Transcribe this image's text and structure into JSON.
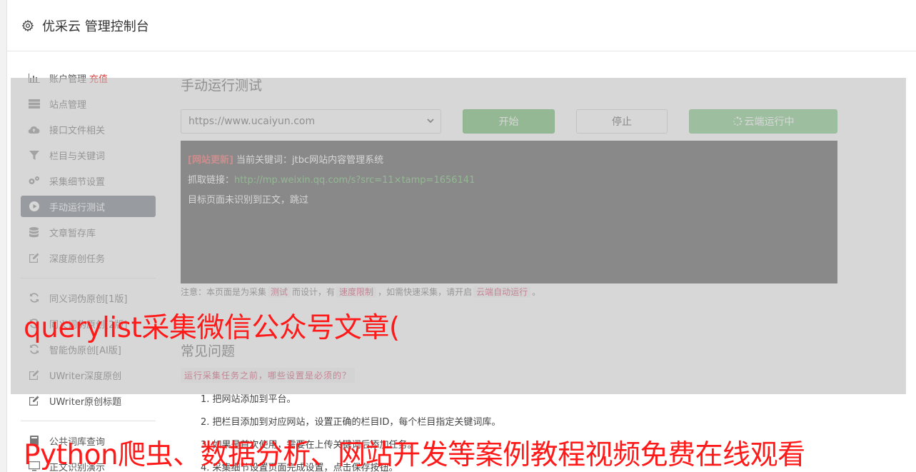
{
  "header": {
    "title": "优采云 管理控制台",
    "icon": "gear-icon"
  },
  "sidebar": {
    "items": [
      {
        "label": "账户管理",
        "extra": "充值",
        "icon": "bar-chart-icon"
      },
      {
        "label": "站点管理",
        "icon": "server-icon"
      },
      {
        "label": "接口文件相关",
        "icon": "cloud-upload-icon"
      },
      {
        "label": "栏目与关键词",
        "icon": "filter-icon"
      },
      {
        "label": "采集细节设置",
        "icon": "gears-icon"
      },
      {
        "label": "手动运行测试",
        "icon": "play-circle-icon",
        "active": true
      },
      {
        "label": "文章暂存库",
        "icon": "database-icon"
      },
      {
        "label": "深度原创任务",
        "icon": "edit-icon"
      },
      {
        "label": "同义词伪原创[1版]",
        "icon": "refresh-icon"
      },
      {
        "label": "同义词伪原创[2版]",
        "icon": "refresh-icon"
      },
      {
        "label": "智能伪原创[AI版]",
        "icon": "refresh-icon"
      },
      {
        "label": "UWriter深度原创",
        "icon": "edit-icon"
      },
      {
        "label": "UWriter原创标题",
        "icon": "edit-icon"
      },
      {
        "label": "公共词库查询",
        "icon": "book-icon"
      },
      {
        "label": "正文识别演示",
        "icon": "monitor-icon"
      }
    ]
  },
  "main": {
    "title": "手动运行测试",
    "select_value": "https://www.ucaiyun.com",
    "btn_start": "开始",
    "btn_stop": "停止",
    "btn_cloud": "云端运行中",
    "console": {
      "line1_tag": "[网站更新]",
      "line1_text": "当前关键词：jtbc网站内容管理系统",
      "line2_label": "抓取链接：",
      "line2_link": "http://mp.weixin.qq.com/s?src=11×tamp=1656141",
      "line3": "目标页面未识别到正文，跳过"
    },
    "note": {
      "p1": "注意：本页面是为采集",
      "c1": "测试",
      "p2": "而设计，有",
      "c2": "速度限制",
      "p3": "，如需快速采集，请开启",
      "c3": "云端自动运行",
      "p4": "。"
    },
    "faq_title": "常见问题",
    "faq_question": "运行采集任务之前，哪些设置是必须的？",
    "faq_items": [
      "1. 把网站添加到平台。",
      "2. 把栏目添加到对应网站，设置正确的栏目ID，每个栏目指定关键词库。",
      "3. 如果是首次使用，需要在上传关键词后添加任务。",
      "4. 采集细节设置页面完成设置，点击保存按钮。"
    ]
  },
  "watermark": {
    "line1": "querylist采集微信公众号文章(",
    "line2": "Python爬虫、数据分析、网站开发等案例教程视频免费在线观看"
  }
}
